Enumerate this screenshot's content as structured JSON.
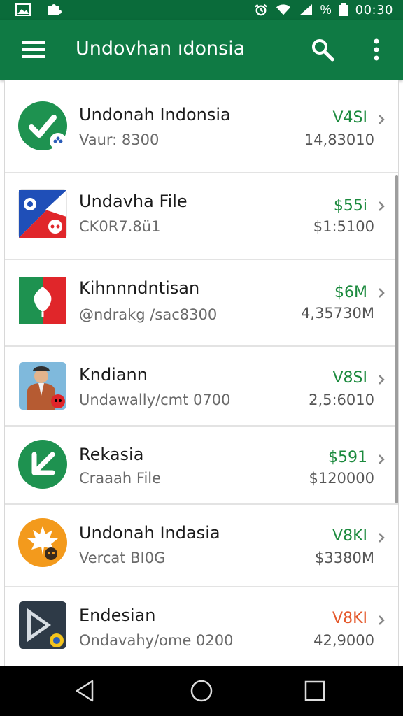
{
  "status_bar": {
    "time": "00:30",
    "battery_label": "%",
    "icons": [
      "gallery-icon",
      "puzzle-icon",
      "alarm-icon",
      "wifi-icon",
      "signal-icon",
      "battery-icon"
    ]
  },
  "app_bar": {
    "title": "Undovhan ıdonsia",
    "icons": [
      "menu-icon",
      "search-icon",
      "more-vert-icon"
    ]
  },
  "colors": {
    "status_bar": "#0a6b3a",
    "app_bar": "#0f7a44",
    "price_green": "#1c8a3e",
    "price_orange": "#e4582b"
  },
  "apps": [
    {
      "title": "Undonah Indonsia",
      "subtitle": "Vaur: 8300",
      "price": "V4SI",
      "count": "14,83010",
      "price_color": "#1c8a3e",
      "icon": "check-circle-icon"
    },
    {
      "title": "Undavha File",
      "subtitle": "CK0R7.8ü1",
      "price": "$55i",
      "count": "$1:5100",
      "price_color": "#1c8a3e",
      "icon": "file-flag-icon"
    },
    {
      "title": "Kihnnndntisan",
      "subtitle": "@ndrakg /sac8300",
      "price": "$6M",
      "count": "4,35730M",
      "price_color": "#1c8a3e",
      "icon": "leaf-flag-icon"
    },
    {
      "title": "Kndiann",
      "subtitle": "Undawally/cmt 0700",
      "price": "V8SI",
      "count": "2,5:6010",
      "price_color": "#1c8a3e",
      "icon": "person-avatar-icon"
    },
    {
      "title": "Rekasia",
      "subtitle": "Craaah File",
      "price": "$591",
      "count": "$120000",
      "price_color": "#1c8a3e",
      "icon": "arrow-circle-icon"
    },
    {
      "title": "Undonah Indasia",
      "subtitle": "Vercat BI0G",
      "price": "V8KI",
      "count": "$3380M",
      "price_color": "#1c8a3e",
      "icon": "maple-leaf-icon"
    },
    {
      "title": "Endesian",
      "subtitle": "Ondavahy/ome 0200",
      "price": "V8KI",
      "count": "42,9000",
      "price_color": "#e4582b",
      "icon": "play-icon"
    }
  ],
  "nav_bar": {
    "icons": [
      "back-icon",
      "home-icon",
      "recents-icon"
    ]
  }
}
